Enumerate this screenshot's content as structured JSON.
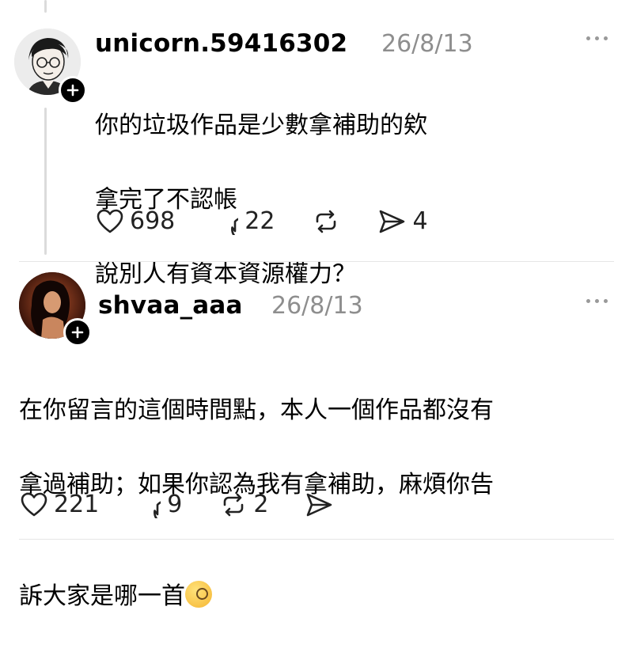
{
  "post1": {
    "username": "unicorn.59416302",
    "date": "26/8/13",
    "lines": [
      "你的垃圾作品是少數拿補助的欸",
      "拿完了不認帳",
      "說別人有資本資源權力？"
    ],
    "likes": "698",
    "replies": "22",
    "shares": "4"
  },
  "post2": {
    "username": "shvaa_aaa",
    "date": "26/8/13",
    "lines": [
      "在你留言的這個時間點，本人一個作品都沒有",
      "拿過補助；如果你認為我有拿補助，麻煩你告",
      "訴大家是哪一首"
    ],
    "likes": "221",
    "replies": "9",
    "reposts": "2"
  },
  "icons": {
    "like": "heart-icon",
    "reply": "comment-icon",
    "repost": "repost-icon",
    "share": "send-icon",
    "more": "more-icon",
    "follow": "plus-icon",
    "emoji": "face-with-monocle-emoji"
  },
  "colors": {
    "muted": "#8e8e8e",
    "thread_line": "#dbdbdb"
  }
}
